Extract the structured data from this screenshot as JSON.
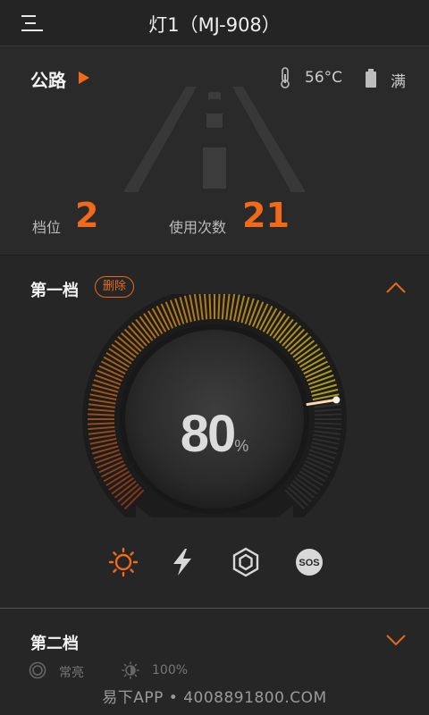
{
  "header": {
    "title": "灯1（MJ-908）",
    "menu_icon": "menu-icon"
  },
  "mode": {
    "name": "公路",
    "arrow_icon": "play-arrow-icon",
    "road_icon": "road-icon"
  },
  "status": {
    "temperature": "56°C",
    "battery": "满",
    "temp_icon": "thermometer-icon",
    "battery_icon": "battery-icon"
  },
  "stats": {
    "gear_label": "档位",
    "gear_value": "2",
    "uses_label": "使用次数",
    "uses_value": "21"
  },
  "level1": {
    "title": "第一档",
    "delete_label": "删除",
    "collapse_icon": "chevron-up-icon",
    "brightness_value": "80",
    "brightness_unit": "%",
    "brightness_level": 0.8,
    "modes": [
      "sun-icon",
      "flash-icon",
      "strobe-icon",
      "sos-icon"
    ],
    "selected_mode": "sun-icon"
  },
  "level2": {
    "title": "第二档",
    "expand_icon": "chevron-down-icon",
    "mode_label": "常亮",
    "brightness_label": "100%"
  },
  "watermark": "易下APP • 4008891800.COM",
  "colors": {
    "accent": "#f06a1a",
    "background": "#262626",
    "gauge_yellow": "#d4b81a",
    "gauge_orange": "#e0801a"
  }
}
